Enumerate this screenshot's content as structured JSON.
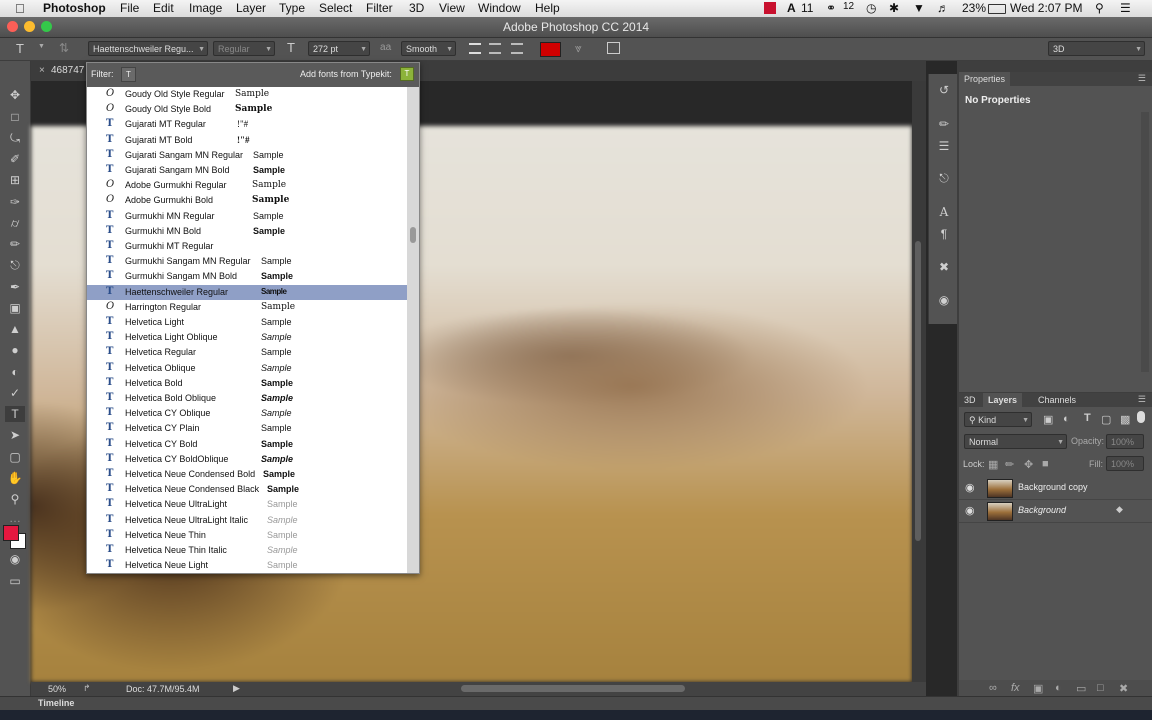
{
  "menubar": {
    "app": "Photoshop",
    "items": [
      "File",
      "Edit",
      "Image",
      "Layer",
      "Type",
      "Select",
      "Filter",
      "3D",
      "View",
      "Window",
      "Help"
    ],
    "status": {
      "adobe_count": "11",
      "cc_count": "12",
      "battery": "23%",
      "clock": "Wed 2:07 PM"
    }
  },
  "window": {
    "title": "Adobe Photoshop CC 2014"
  },
  "options": {
    "font_family": "Haettenschweiler Regu...",
    "font_style": "Regular",
    "font_size": "272 pt",
    "antialias": "Smooth",
    "aa_label": "a",
    "workspace": "3D",
    "text_color": "#d00000"
  },
  "document": {
    "tab_label": "468747",
    "zoom": "50%",
    "doc_info": "Doc: 47.7M/95.4M"
  },
  "font_panel": {
    "filter_label": "Filter:",
    "typekit_label": "Add fonts from Typekit:",
    "fonts": [
      {
        "icon": "O",
        "name": "Goudy Old Style Regular",
        "sample": "Sample",
        "selected": false
      },
      {
        "icon": "O",
        "name": "Goudy Old Style Bold",
        "sample": "Sample",
        "selected": false
      },
      {
        "icon": "T",
        "name": "Gujarati MT Regular",
        "sample": "!\"#",
        "selected": false
      },
      {
        "icon": "T",
        "name": "Gujarati MT Bold",
        "sample": "!\"#",
        "selected": false
      },
      {
        "icon": "T",
        "name": "Gujarati Sangam MN Regular",
        "sample": "Sample",
        "selected": false
      },
      {
        "icon": "T",
        "name": "Gujarati Sangam MN Bold",
        "sample": "Sample",
        "selected": false
      },
      {
        "icon": "O",
        "name": "Adobe Gurmukhi Regular",
        "sample": "Sample",
        "selected": false
      },
      {
        "icon": "O",
        "name": "Adobe Gurmukhi Bold",
        "sample": "Sample",
        "selected": false
      },
      {
        "icon": "T",
        "name": "Gurmukhi MN Regular",
        "sample": "Sample",
        "selected": false
      },
      {
        "icon": "T",
        "name": "Gurmukhi MN Bold",
        "sample": "Sample",
        "selected": false
      },
      {
        "icon": "T",
        "name": "Gurmukhi MT Regular",
        "sample": "",
        "selected": false
      },
      {
        "icon": "T",
        "name": "Gurmukhi Sangam MN Regular",
        "sample": "Sample",
        "selected": false
      },
      {
        "icon": "T",
        "name": "Gurmukhi Sangam MN Bold",
        "sample": "Sample",
        "selected": false
      },
      {
        "icon": "T",
        "name": "Haettenschweiler Regular",
        "sample": "Sample",
        "selected": true
      },
      {
        "icon": "O",
        "name": "Harrington Regular",
        "sample": "Sample",
        "selected": false
      },
      {
        "icon": "T",
        "name": "Helvetica Light",
        "sample": "Sample",
        "selected": false
      },
      {
        "icon": "T",
        "name": "Helvetica Light Oblique",
        "sample": "Sample",
        "selected": false
      },
      {
        "icon": "T",
        "name": "Helvetica Regular",
        "sample": "Sample",
        "selected": false
      },
      {
        "icon": "T",
        "name": "Helvetica Oblique",
        "sample": "Sample",
        "selected": false
      },
      {
        "icon": "T",
        "name": "Helvetica Bold",
        "sample": "Sample",
        "selected": false
      },
      {
        "icon": "T",
        "name": "Helvetica Bold Oblique",
        "sample": "Sample",
        "selected": false
      },
      {
        "icon": "T",
        "name": "Helvetica CY Oblique",
        "sample": "Sample",
        "selected": false
      },
      {
        "icon": "T",
        "name": "Helvetica CY Plain",
        "sample": "Sample",
        "selected": false
      },
      {
        "icon": "T",
        "name": "Helvetica CY Bold",
        "sample": "Sample",
        "selected": false
      },
      {
        "icon": "T",
        "name": "Helvetica CY BoldOblique",
        "sample": "Sample",
        "selected": false
      },
      {
        "icon": "T",
        "name": "Helvetica Neue Condensed Bold",
        "sample": "Sample",
        "selected": false
      },
      {
        "icon": "T",
        "name": "Helvetica Neue Condensed Black",
        "sample": "Sample",
        "selected": false
      },
      {
        "icon": "T",
        "name": "Helvetica Neue UltraLight",
        "sample": "Sample",
        "selected": false
      },
      {
        "icon": "T",
        "name": "Helvetica Neue UltraLight Italic",
        "sample": "Sample",
        "selected": false
      },
      {
        "icon": "T",
        "name": "Helvetica Neue Thin",
        "sample": "Sample",
        "selected": false
      },
      {
        "icon": "T",
        "name": "Helvetica Neue Thin Italic",
        "sample": "Sample",
        "selected": false
      },
      {
        "icon": "T",
        "name": "Helvetica Neue Light",
        "sample": "Sample",
        "selected": false
      }
    ]
  },
  "properties": {
    "tab": "Properties",
    "empty": "No Properties"
  },
  "layers_panel": {
    "tabs": [
      "3D",
      "Layers",
      "Channels"
    ],
    "kind": "Kind",
    "blend": "Normal",
    "opacity_label": "Opacity:",
    "opacity": "100%",
    "lock_label": "Lock:",
    "fill_label": "Fill:",
    "fill": "100%",
    "layers": [
      {
        "name": "Background copy",
        "italic": false
      },
      {
        "name": "Background",
        "italic": true
      }
    ]
  },
  "timeline": {
    "label": "Timeline"
  }
}
